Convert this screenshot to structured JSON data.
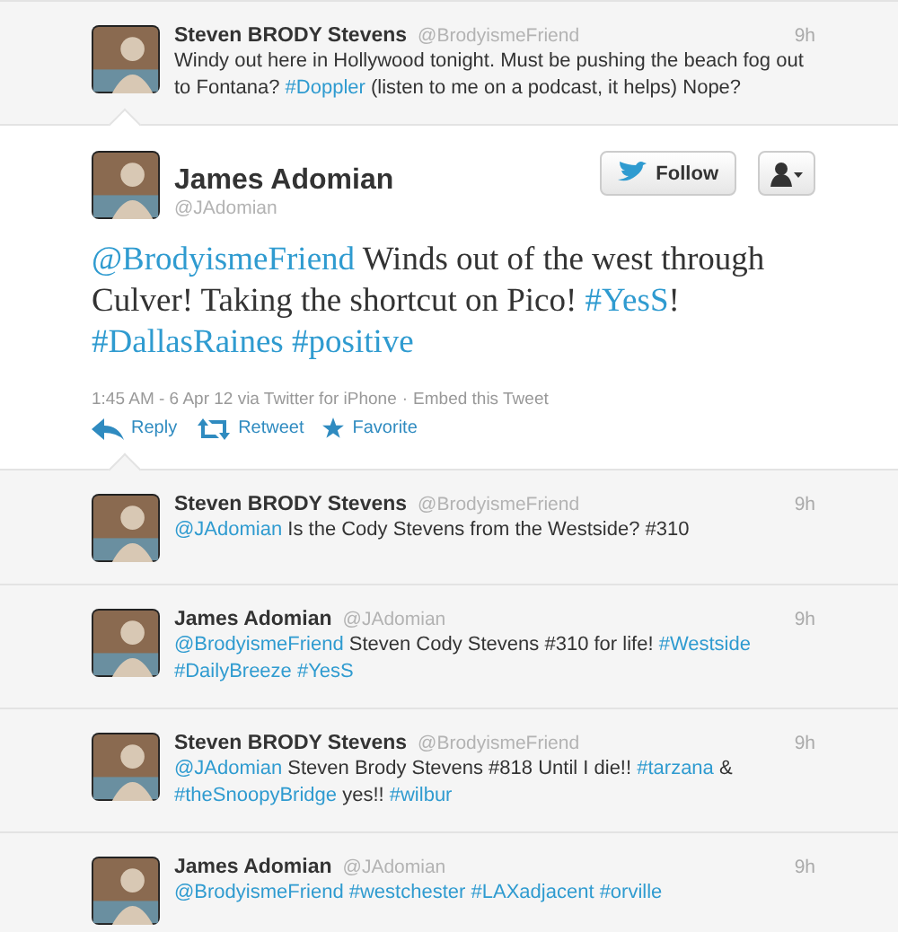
{
  "before": [
    {
      "name": "Steven BRODY Stevens",
      "handle": "@BrodyismeFriend",
      "time": "9h",
      "text": [
        {
          "kind": "text",
          "s": "Windy out here in Hollywood tonight. Must be pushing the beach fog out to Fontana?"
        },
        {
          "kind": "link",
          "s": "#Doppler"
        },
        {
          "kind": "text",
          "s": "(listen to me on a podcast, it helps) Nope?"
        }
      ]
    }
  ],
  "main": {
    "name": "James Adomian",
    "handle": "@JAdomian",
    "follow": "Follow",
    "text": [
      {
        "kind": "link",
        "s": "@BrodyismeFriend"
      },
      {
        "kind": "text",
        "s": "Winds out of the west through Culver! Taking the shortcut on Pico!"
      },
      {
        "kind": "link",
        "s": "#YesS"
      },
      {
        "kind": "text",
        "s": "!",
        "attached": true
      },
      {
        "kind": "link",
        "s": "#DallasRaines"
      },
      {
        "kind": "link",
        "s": "#positive"
      }
    ],
    "meta": "1:45 AM - 6 Apr 12 via Twitter for iPhone",
    "separator": "·",
    "embed": "Embed this Tweet",
    "actions": [
      {
        "kind": "reply",
        "label": "Reply"
      },
      {
        "kind": "retweet",
        "label": "Retweet"
      },
      {
        "kind": "favorite",
        "label": "Favorite"
      }
    ]
  },
  "replies": [
    {
      "name": "Steven BRODY Stevens",
      "handle": "@BrodyismeFriend",
      "time": "9h",
      "text": [
        {
          "kind": "link",
          "s": "@JAdomian"
        },
        {
          "kind": "text",
          "s": "Is the Cody Stevens from the Westside? #310"
        }
      ]
    },
    {
      "name": "James Adomian",
      "handle": "@JAdomian",
      "time": "9h",
      "text": [
        {
          "kind": "link",
          "s": "@BrodyismeFriend"
        },
        {
          "kind": "text",
          "s": "Steven Cody Stevens #310 for life!"
        },
        {
          "kind": "link",
          "s": "#Westside"
        },
        {
          "kind": "link",
          "s": "#DailyBreeze"
        },
        {
          "kind": "link",
          "s": "#YesS"
        }
      ]
    },
    {
      "name": "Steven BRODY Stevens",
      "handle": "@BrodyismeFriend",
      "time": "9h",
      "text": [
        {
          "kind": "link",
          "s": "@JAdomian"
        },
        {
          "kind": "text",
          "s": "Steven Brody Stevens #818 Until I die!!"
        },
        {
          "kind": "link",
          "s": "#tarzana"
        },
        {
          "kind": "text",
          "s": "&"
        },
        {
          "kind": "link",
          "s": "#theSnoopyBridge"
        },
        {
          "kind": "text",
          "s": "yes!!"
        },
        {
          "kind": "link",
          "s": "#wilbur"
        }
      ]
    },
    {
      "name": "James Adomian",
      "handle": "@JAdomian",
      "time": "9h",
      "text": [
        {
          "kind": "link",
          "s": "@BrodyismeFriend"
        },
        {
          "kind": "link",
          "s": "#westchester"
        },
        {
          "kind": "link",
          "s": "#LAXadjacent"
        },
        {
          "kind": "link",
          "s": "#orville"
        }
      ]
    }
  ]
}
